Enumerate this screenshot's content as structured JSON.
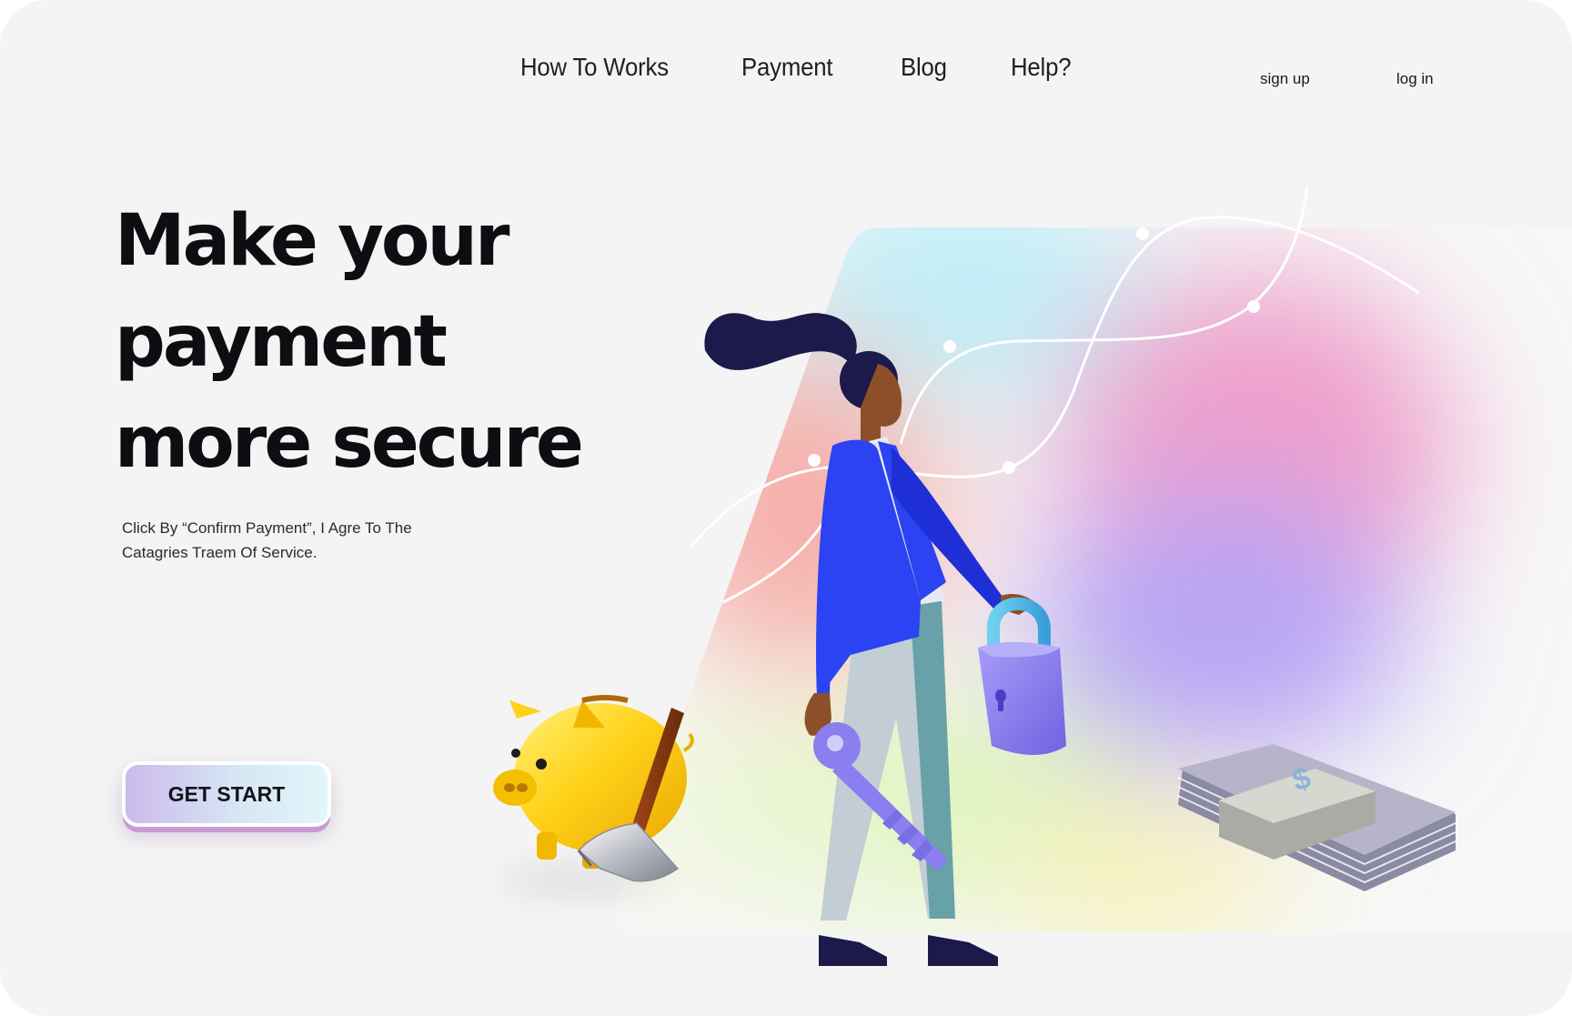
{
  "nav": {
    "items": [
      "How To Works",
      "Payment",
      "Blog",
      "Help?"
    ]
  },
  "auth": {
    "signup": "sign up",
    "login": "log in"
  },
  "hero": {
    "headline": [
      "Make your",
      "payment",
      "more secure"
    ],
    "subtitle": "Click By “Confirm Payment”, I Agre To The Catagries Traem Of Service.",
    "cta_label": "GET START"
  },
  "icons": [
    "piggy-bank-icon",
    "hammer-icon",
    "padlock-icon",
    "key-icon",
    "dollar-bills-icon",
    "woman-illustration"
  ],
  "colors": {
    "background": "#f4f4f4",
    "text": "#0d0d12",
    "jacket_blue": "#2b43f2",
    "lock_purple": "#8a7ef0",
    "piggy_yellow": "#ffd21a",
    "cta_gradient_start": "#cbb9ec",
    "cta_gradient_end": "#e2f6fb"
  }
}
